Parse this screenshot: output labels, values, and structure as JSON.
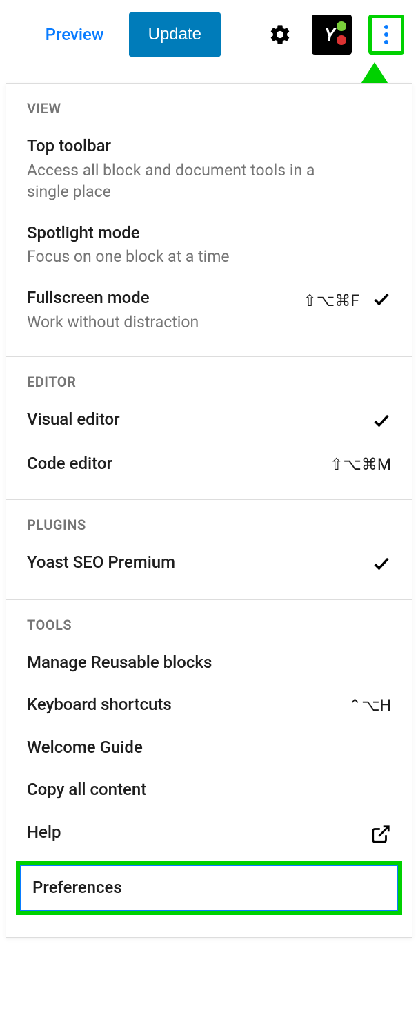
{
  "toolbar": {
    "preview": "Preview",
    "update": "Update"
  },
  "menu": {
    "view": {
      "header": "View",
      "top_toolbar": {
        "title": "Top toolbar",
        "desc": "Access all block and document tools in a single place"
      },
      "spotlight": {
        "title": "Spotlight mode",
        "desc": "Focus on one block at a time"
      },
      "fullscreen": {
        "title": "Fullscreen mode",
        "desc": "Work without distraction",
        "shortcut": "⇧⌥⌘F"
      }
    },
    "editor": {
      "header": "Editor",
      "visual": {
        "title": "Visual editor"
      },
      "code": {
        "title": "Code editor",
        "shortcut": "⇧⌥⌘M"
      }
    },
    "plugins": {
      "header": "Plugins",
      "yoast": {
        "title": "Yoast SEO Premium"
      }
    },
    "tools": {
      "header": "Tools",
      "reusable": {
        "title": "Manage Reusable blocks"
      },
      "shortcuts": {
        "title": "Keyboard shortcuts",
        "shortcut": "⌃⌥H"
      },
      "welcome": {
        "title": "Welcome Guide"
      },
      "copyall": {
        "title": "Copy all content"
      },
      "help": {
        "title": "Help"
      },
      "preferences": {
        "title": "Preferences"
      }
    }
  }
}
